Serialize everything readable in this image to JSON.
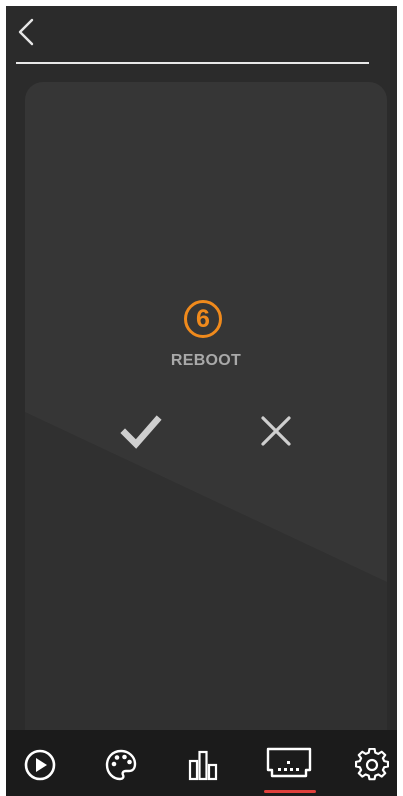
{
  "header": {
    "back_icon": "chevron-left-icon"
  },
  "dialog": {
    "step_number": "6",
    "title": "REBOOT",
    "confirm_icon": "check-icon",
    "cancel_icon": "close-icon",
    "accent_color": "#f08a1c"
  },
  "tabbar": {
    "active_index": 3,
    "indicator_color": "#e0403c",
    "tabs": [
      {
        "icon": "play-circle-icon"
      },
      {
        "icon": "palette-icon"
      },
      {
        "icon": "equalizer-bars-icon"
      },
      {
        "icon": "screen-device-icon"
      },
      {
        "icon": "gear-icon"
      }
    ]
  }
}
